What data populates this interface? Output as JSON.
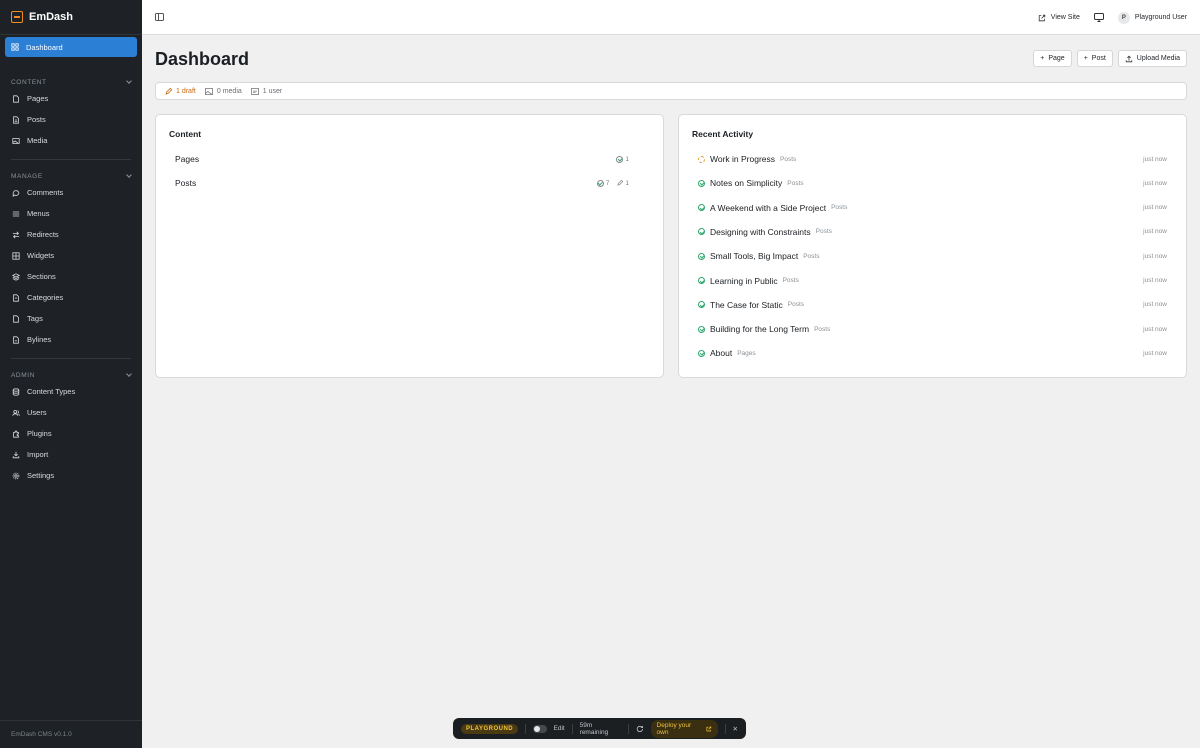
{
  "app": {
    "brand": "EmDash",
    "version": "EmDash CMS v0.1.0"
  },
  "sidebar": {
    "active": {
      "label": "Dashboard",
      "icon": "grid-icon"
    },
    "sections": [
      {
        "title": "CONTENT",
        "items": [
          {
            "label": "Pages",
            "icon": "page-icon"
          },
          {
            "label": "Posts",
            "icon": "post-icon"
          },
          {
            "label": "Media",
            "icon": "image-icon"
          }
        ]
      },
      {
        "title": "MANAGE",
        "items": [
          {
            "label": "Comments",
            "icon": "comment-icon"
          },
          {
            "label": "Menus",
            "icon": "menu-icon"
          },
          {
            "label": "Redirects",
            "icon": "redirect-icon"
          },
          {
            "label": "Widgets",
            "icon": "widget-icon"
          },
          {
            "label": "Sections",
            "icon": "layers-icon"
          },
          {
            "label": "Categories",
            "icon": "folder-icon"
          },
          {
            "label": "Tags",
            "icon": "tag-icon"
          },
          {
            "label": "Bylines",
            "icon": "byline-icon"
          }
        ]
      },
      {
        "title": "ADMIN",
        "items": [
          {
            "label": "Content Types",
            "icon": "database-icon"
          },
          {
            "label": "Users",
            "icon": "users-icon"
          },
          {
            "label": "Plugins",
            "icon": "plugin-icon"
          },
          {
            "label": "Import",
            "icon": "import-icon"
          },
          {
            "label": "Settings",
            "icon": "gear-icon"
          }
        ]
      }
    ]
  },
  "topbar": {
    "view_site": "View Site",
    "user_initial": "P",
    "user_name": "Playground User"
  },
  "main": {
    "title": "Dashboard",
    "actions": {
      "page": "Page",
      "post": "Post",
      "upload": "Upload Media"
    },
    "stats": {
      "drafts": "1 draft",
      "media": "0 media",
      "users": "1 user"
    }
  },
  "content_card": {
    "title": "Content",
    "rows": [
      {
        "label": "Pages",
        "published": "1",
        "drafts": ""
      },
      {
        "label": "Posts",
        "published": "7",
        "drafts": "1"
      }
    ]
  },
  "activity_card": {
    "title": "Recent Activity",
    "items": [
      {
        "title": "Work in Progress",
        "type": "Posts",
        "time": "just now",
        "status": "draft"
      },
      {
        "title": "Notes on Simplicity",
        "type": "Posts",
        "time": "just now",
        "status": "published"
      },
      {
        "title": "A Weekend with a Side Project",
        "type": "Posts",
        "time": "just now",
        "status": "published"
      },
      {
        "title": "Designing with Constraints",
        "type": "Posts",
        "time": "just now",
        "status": "published"
      },
      {
        "title": "Small Tools, Big Impact",
        "type": "Posts",
        "time": "just now",
        "status": "published"
      },
      {
        "title": "Learning in Public",
        "type": "Posts",
        "time": "just now",
        "status": "published"
      },
      {
        "title": "The Case for Static",
        "type": "Posts",
        "time": "just now",
        "status": "published"
      },
      {
        "title": "Building for the Long Term",
        "type": "Posts",
        "time": "just now",
        "status": "published"
      },
      {
        "title": "About",
        "type": "Pages",
        "time": "just now",
        "status": "published"
      }
    ]
  },
  "playground_bar": {
    "badge": "PLAYGROUND",
    "edit": "Edit",
    "remaining": "59m remaining",
    "deploy": "Deploy your own",
    "close": "✕"
  },
  "colors": {
    "sidebar_bg": "#1e2226",
    "accent": "#2b7fd4",
    "brand": "#f08a24",
    "draft": "#c86a12",
    "published": "#2ea66b",
    "playground": "#f0c23b"
  }
}
